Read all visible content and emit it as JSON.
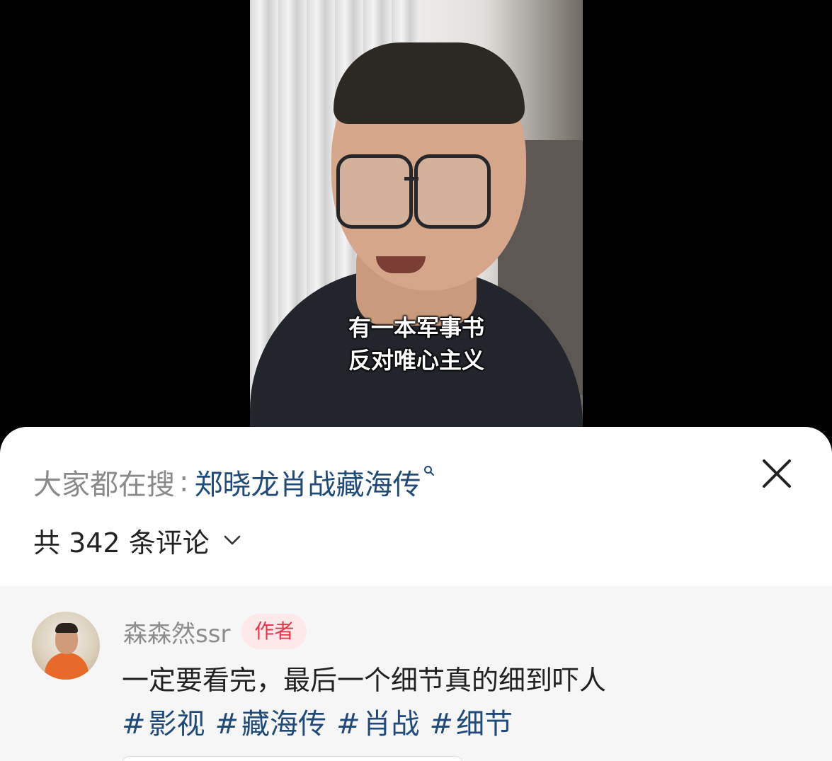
{
  "video": {
    "subtitle_line1": "有一本军事书",
    "subtitle_line2": "反对唯心主义"
  },
  "search": {
    "prefix": "大家都在搜",
    "colon": ":",
    "term": "郑晓龙肖战藏海传",
    "icon": "search-icon"
  },
  "comments": {
    "count_label": "共 342 条评论",
    "items": [
      {
        "username": "森森然ssr",
        "badge": "作者",
        "text": "一定要看完，最后一个细节真的细到吓人",
        "tags": [
          "影视",
          "藏海传",
          "肖战",
          "细节"
        ]
      }
    ]
  },
  "colors": {
    "link_blue": "#204a7a",
    "badge_red": "#e8354a",
    "badge_bg": "#fde8ea"
  }
}
